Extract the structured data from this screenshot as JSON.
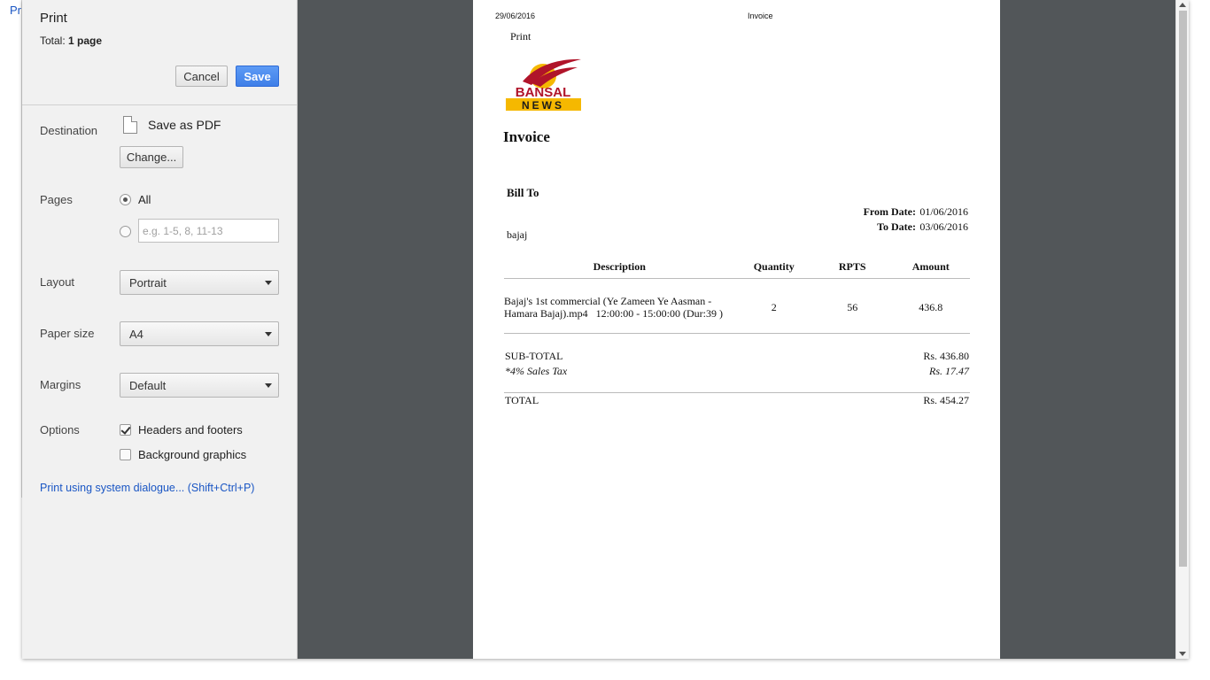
{
  "background": {
    "link_fragment": "Pri"
  },
  "sidebar": {
    "title": "Print",
    "total_label": "Total:",
    "total_value": "1 page",
    "cancel_label": "Cancel",
    "save_label": "Save",
    "destination": {
      "label": "Destination",
      "value": "Save as PDF",
      "change_label": "Change..."
    },
    "pages": {
      "label": "Pages",
      "all_label": "All",
      "custom_placeholder": "e.g. 1-5, 8, 11-13",
      "selected": "All"
    },
    "layout": {
      "label": "Layout",
      "value": "Portrait"
    },
    "paper_size": {
      "label": "Paper size",
      "value": "A4"
    },
    "margins": {
      "label": "Margins",
      "value": "Default"
    },
    "options": {
      "label": "Options",
      "headers_footers_label": "Headers and footers",
      "headers_footers_checked": true,
      "background_graphics_label": "Background graphics",
      "background_graphics_checked": false
    },
    "system_dialog_link": "Print using system dialogue... (Shift+Ctrl+P)"
  },
  "preview": {
    "header_date": "29/06/2016",
    "header_title": "Invoice",
    "print_word": "Print",
    "logo": {
      "top_text": "BANSAL",
      "bottom_text": "NEWS",
      "red": "#b0142a",
      "gold": "#f5b800"
    },
    "invoice_heading": "Invoice",
    "bill_to_label": "Bill To",
    "customer_name": "bajaj",
    "from_date_label": "From Date:",
    "from_date": "01/06/2016",
    "to_date_label": "To Date:",
    "to_date": "03/06/2016",
    "table": {
      "headers": [
        "Description",
        "Quantity",
        "RPTS",
        "Amount"
      ],
      "rows": [
        {
          "description_line1": "Bajaj's 1st commercial (Ye Zameen Ye Aasman -",
          "description_line2": "Hamara Bajaj).mp4   12:00:00 - 15:00:00 (Dur:39 )",
          "quantity": "2",
          "rpts": "56",
          "amount": "436.8"
        }
      ]
    },
    "subtotal_label": "SUB-TOTAL",
    "subtotal_value": "Rs. 436.80",
    "tax_label": "*4% Sales Tax",
    "tax_value": "Rs. 17.47",
    "total_label": "TOTAL",
    "total_value": "Rs. 454.27"
  }
}
